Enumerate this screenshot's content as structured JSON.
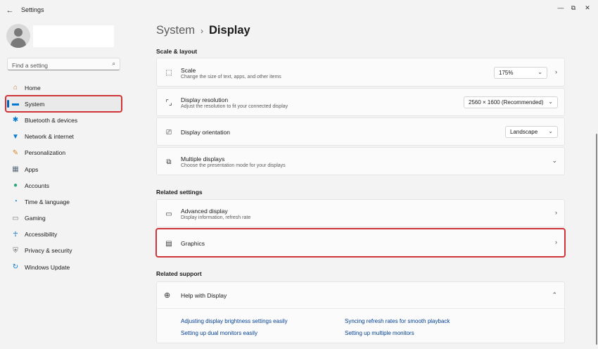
{
  "window": {
    "title": "Settings",
    "back_icon": "←",
    "minimize": "—",
    "maximize": "⧉",
    "close": "✕"
  },
  "search": {
    "placeholder": "Find a setting",
    "icon": "⌕"
  },
  "sidebar": {
    "items": [
      {
        "label": "Home",
        "icon": "home-icon",
        "glyph": "⌂",
        "color": "#c07a3a"
      },
      {
        "label": "System",
        "icon": "system-icon",
        "glyph": "▬",
        "color": "#0078d4"
      },
      {
        "label": "Bluetooth & devices",
        "icon": "bluetooth-icon",
        "glyph": "✱",
        "color": "#0078d4"
      },
      {
        "label": "Network & internet",
        "icon": "network-icon",
        "glyph": "▼",
        "color": "#0a7cd1"
      },
      {
        "label": "Personalization",
        "icon": "personalization-icon",
        "glyph": "✎",
        "color": "#d08a2c"
      },
      {
        "label": "Apps",
        "icon": "apps-icon",
        "glyph": "▦",
        "color": "#5a6b7a"
      },
      {
        "label": "Accounts",
        "icon": "accounts-icon",
        "glyph": "●",
        "color": "#2fa37a"
      },
      {
        "label": "Time & language",
        "icon": "time-language-icon",
        "glyph": "◔",
        "color": "#1e88c8"
      },
      {
        "label": "Gaming",
        "icon": "gaming-icon",
        "glyph": "▭",
        "color": "#7a7a7a"
      },
      {
        "label": "Accessibility",
        "icon": "accessibility-icon",
        "glyph": "☥",
        "color": "#1a73c7"
      },
      {
        "label": "Privacy & security",
        "icon": "shield-icon",
        "glyph": "⛨",
        "color": "#6a6a6a"
      },
      {
        "label": "Windows Update",
        "icon": "windows-update-icon",
        "glyph": "↻",
        "color": "#0a7cd1"
      }
    ]
  },
  "breadcrumb": {
    "parent": "System",
    "separator": "›",
    "current": "Display"
  },
  "scale_layout": {
    "title": "Scale & layout",
    "scale": {
      "title": "Scale",
      "subtitle": "Change the size of text, apps, and other items",
      "value": "175%"
    },
    "resolution": {
      "title": "Display resolution",
      "subtitle": "Adjust the resolution to fit your connected display",
      "value": "2560 × 1600 (Recommended)"
    },
    "orientation": {
      "title": "Display orientation",
      "value": "Landscape"
    },
    "multiple": {
      "title": "Multiple displays",
      "subtitle": "Choose the presentation mode for your displays"
    }
  },
  "related_settings": {
    "title": "Related settings",
    "advanced": {
      "title": "Advanced display",
      "subtitle": "Display information, refresh rate"
    },
    "graphics": {
      "title": "Graphics"
    }
  },
  "related_support": {
    "title": "Related support",
    "help": {
      "title": "Help with Display"
    },
    "links": [
      "Adjusting display brightness settings easily",
      "Syncing refresh rates for smooth playback",
      "Setting up dual monitors easily",
      "Setting up multiple monitors"
    ]
  },
  "glyphs": {
    "chevron_right": "›",
    "chevron_down": "⌄",
    "chevron_up": "⌃"
  }
}
